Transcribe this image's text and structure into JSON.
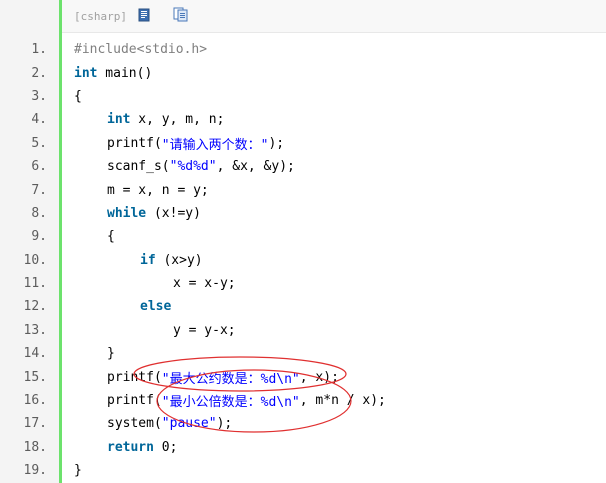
{
  "toolbar": {
    "language": "[csharp]",
    "icons": [
      "view-source-icon",
      "copy-icon"
    ]
  },
  "lines": [
    {
      "n": "1.",
      "indent": 0,
      "tokens": [
        {
          "t": "pre",
          "v": "#include<stdio.h>"
        }
      ]
    },
    {
      "n": "2.",
      "indent": 0,
      "tokens": [
        {
          "t": "kw",
          "v": "int"
        },
        {
          "t": "p",
          "v": " main()"
        }
      ]
    },
    {
      "n": "3.",
      "indent": 0,
      "tokens": [
        {
          "t": "p",
          "v": "{"
        }
      ]
    },
    {
      "n": "4.",
      "indent": 1,
      "tokens": [
        {
          "t": "kw",
          "v": "int"
        },
        {
          "t": "p",
          "v": " x, y, m, n;"
        }
      ]
    },
    {
      "n": "5.",
      "indent": 1,
      "tokens": [
        {
          "t": "p",
          "v": "printf("
        },
        {
          "t": "str",
          "v": "\"请输入两个数：\""
        },
        {
          "t": "p",
          "v": ");"
        }
      ]
    },
    {
      "n": "6.",
      "indent": 1,
      "tokens": [
        {
          "t": "p",
          "v": "scanf_s("
        },
        {
          "t": "str",
          "v": "\"%d%d\""
        },
        {
          "t": "p",
          "v": ", &x, &y);"
        }
      ]
    },
    {
      "n": "7.",
      "indent": 1,
      "tokens": [
        {
          "t": "p",
          "v": "m = x, n = y;"
        }
      ]
    },
    {
      "n": "8.",
      "indent": 1,
      "tokens": [
        {
          "t": "kw",
          "v": "while"
        },
        {
          "t": "p",
          "v": " (x!=y)"
        }
      ]
    },
    {
      "n": "9.",
      "indent": 1,
      "tokens": [
        {
          "t": "p",
          "v": "{"
        }
      ]
    },
    {
      "n": "10.",
      "indent": 2,
      "tokens": [
        {
          "t": "kw",
          "v": "if"
        },
        {
          "t": "p",
          "v": " (x>y)"
        }
      ]
    },
    {
      "n": "11.",
      "indent": 3,
      "tokens": [
        {
          "t": "p",
          "v": "x = x-y;"
        }
      ]
    },
    {
      "n": "12.",
      "indent": 2,
      "tokens": [
        {
          "t": "kw",
          "v": "else"
        }
      ]
    },
    {
      "n": "13.",
      "indent": 3,
      "tokens": [
        {
          "t": "p",
          "v": "y = y-x;"
        }
      ]
    },
    {
      "n": "14.",
      "indent": 1,
      "tokens": [
        {
          "t": "p",
          "v": "}"
        }
      ]
    },
    {
      "n": "15.",
      "indent": 1,
      "tokens": [
        {
          "t": "p",
          "v": "printf("
        },
        {
          "t": "str",
          "v": "\"最大公约数是：%d\\n\""
        },
        {
          "t": "p",
          "v": ", x);"
        }
      ]
    },
    {
      "n": "16.",
      "indent": 1,
      "tokens": [
        {
          "t": "p",
          "v": "printf("
        },
        {
          "t": "str",
          "v": "\"最小公倍数是：%d\\n\""
        },
        {
          "t": "p",
          "v": ", m*n / x);"
        }
      ]
    },
    {
      "n": "17.",
      "indent": 1,
      "tokens": [
        {
          "t": "p",
          "v": "system("
        },
        {
          "t": "str",
          "v": "\"pause\""
        },
        {
          "t": "p",
          "v": ");"
        }
      ]
    },
    {
      "n": "18.",
      "indent": 1,
      "tokens": [
        {
          "t": "kw",
          "v": "return"
        },
        {
          "t": "p",
          "v": " 0;"
        }
      ]
    },
    {
      "n": "19.",
      "indent": 0,
      "tokens": [
        {
          "t": "p",
          "v": "}"
        }
      ]
    }
  ],
  "colors": {
    "keyword": "#006699",
    "string": "#0000ff",
    "preprocessor": "#808080",
    "gutter_bar": "#6ce26c",
    "annotation": "#e03030"
  }
}
